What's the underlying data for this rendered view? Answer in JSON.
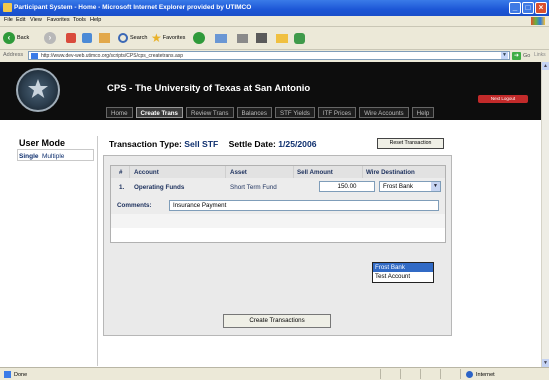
{
  "window": {
    "title": "Participant System - Home - Microsoft Internet Explorer provided by UTIMCO",
    "controls": {
      "minimize": "_",
      "maximize": "□",
      "close": "×"
    }
  },
  "menu": [
    "File",
    "Edit",
    "View",
    "Favorites",
    "Tools",
    "Help"
  ],
  "toolbar": {
    "back": "Back",
    "search": "Search",
    "favorites": "Favorites"
  },
  "address": {
    "label": "Address",
    "url": "http://www.dev-web.utimco.org/scripts/CPS/cps_createtrans.asp",
    "go": "Go",
    "links": "Links"
  },
  "site": {
    "title": "CPS - The University of Texas at San Antonio",
    "logout": "Next Logout",
    "nav": [
      "Home",
      "Create Trans",
      "Review Trans",
      "Balances",
      "STF Yields",
      "ITF Prices",
      "Wire Accounts",
      "Help"
    ],
    "active_nav": "Create Trans"
  },
  "user_mode": {
    "title": "User Mode",
    "single": "Single",
    "multiple": "Multiple"
  },
  "transaction": {
    "type_label": "Transaction  Type:",
    "type_value": "Sell STF",
    "date_label": "Settle Date:",
    "date_value": "1/25/2006",
    "reset_label": "Reset Transaction"
  },
  "table": {
    "headers": [
      "#",
      "Account",
      "Asset",
      "Sell Amount",
      "Wire Destination"
    ],
    "rows": [
      {
        "num": "1.",
        "account": "Operating Funds",
        "asset": "Short Term Fund",
        "amount": "150.00",
        "destination": "Frost Bank"
      }
    ],
    "comments_label": "Comments:",
    "comments_value": "Insurance Payment",
    "dropdown_options": [
      "Frost Bank",
      "Test Account"
    ],
    "dropdown_selected": "Frost Bank"
  },
  "create_button": "Create Transactions",
  "status": {
    "left": "Done",
    "zone": "Internet"
  }
}
